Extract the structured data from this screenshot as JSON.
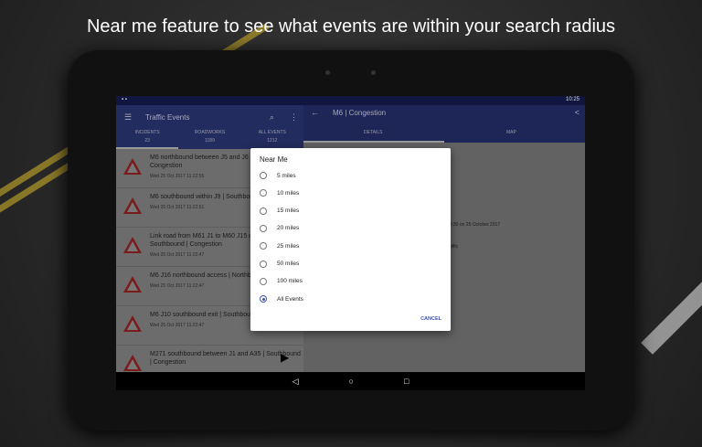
{
  "headline": "Near me feature to see what events are within your search radius",
  "status": {
    "time": "10:25"
  },
  "left": {
    "title": "Traffic Events",
    "tabs": [
      {
        "label": "INCIDENTS",
        "count": "23"
      },
      {
        "label": "ROADWORKS",
        "count": "1189"
      },
      {
        "label": "ALL EVENTS",
        "count": "1212"
      }
    ],
    "items": [
      {
        "title": "M6 northbound between J5 and J6 | Northbound | Congestion",
        "date": "Wed 25 Oct 2017 11:22:55"
      },
      {
        "title": "M6 southbound within J9 | Southbound | Congestion",
        "date": "Wed 25 Oct 2017 11:22:51"
      },
      {
        "title": "Link road from M61 J1 to M60 J15 clockwise | Southbound | Congestion",
        "date": "Wed 25 Oct 2017 11:22:47"
      },
      {
        "title": "M6 J16 northbound access | Northbound | Congestion",
        "date": "Wed 25 Oct 2017 11:22:47"
      },
      {
        "title": "M6 J10 southbound exit | Southbound | Congestion",
        "date": "Wed 25 Oct 2017 11:22:47"
      },
      {
        "title": "M271 southbound between J1 and A35 | Southbound | Congestion",
        "date": ""
      }
    ]
  },
  "right": {
    "title": "M6 | Congestion",
    "tabs": [
      "DETAILS",
      "MAP"
    ],
    "text1": "nd 12:30 on 25 October 2017",
    "text2": "ed traffic"
  },
  "dialog": {
    "title": "Near Me",
    "options": [
      "5 miles",
      "10 miles",
      "15 miles",
      "20 miles",
      "25 miles",
      "50 miles",
      "100 miles",
      "All Events"
    ],
    "selected": "All Events",
    "cancel": "CANCEL"
  }
}
